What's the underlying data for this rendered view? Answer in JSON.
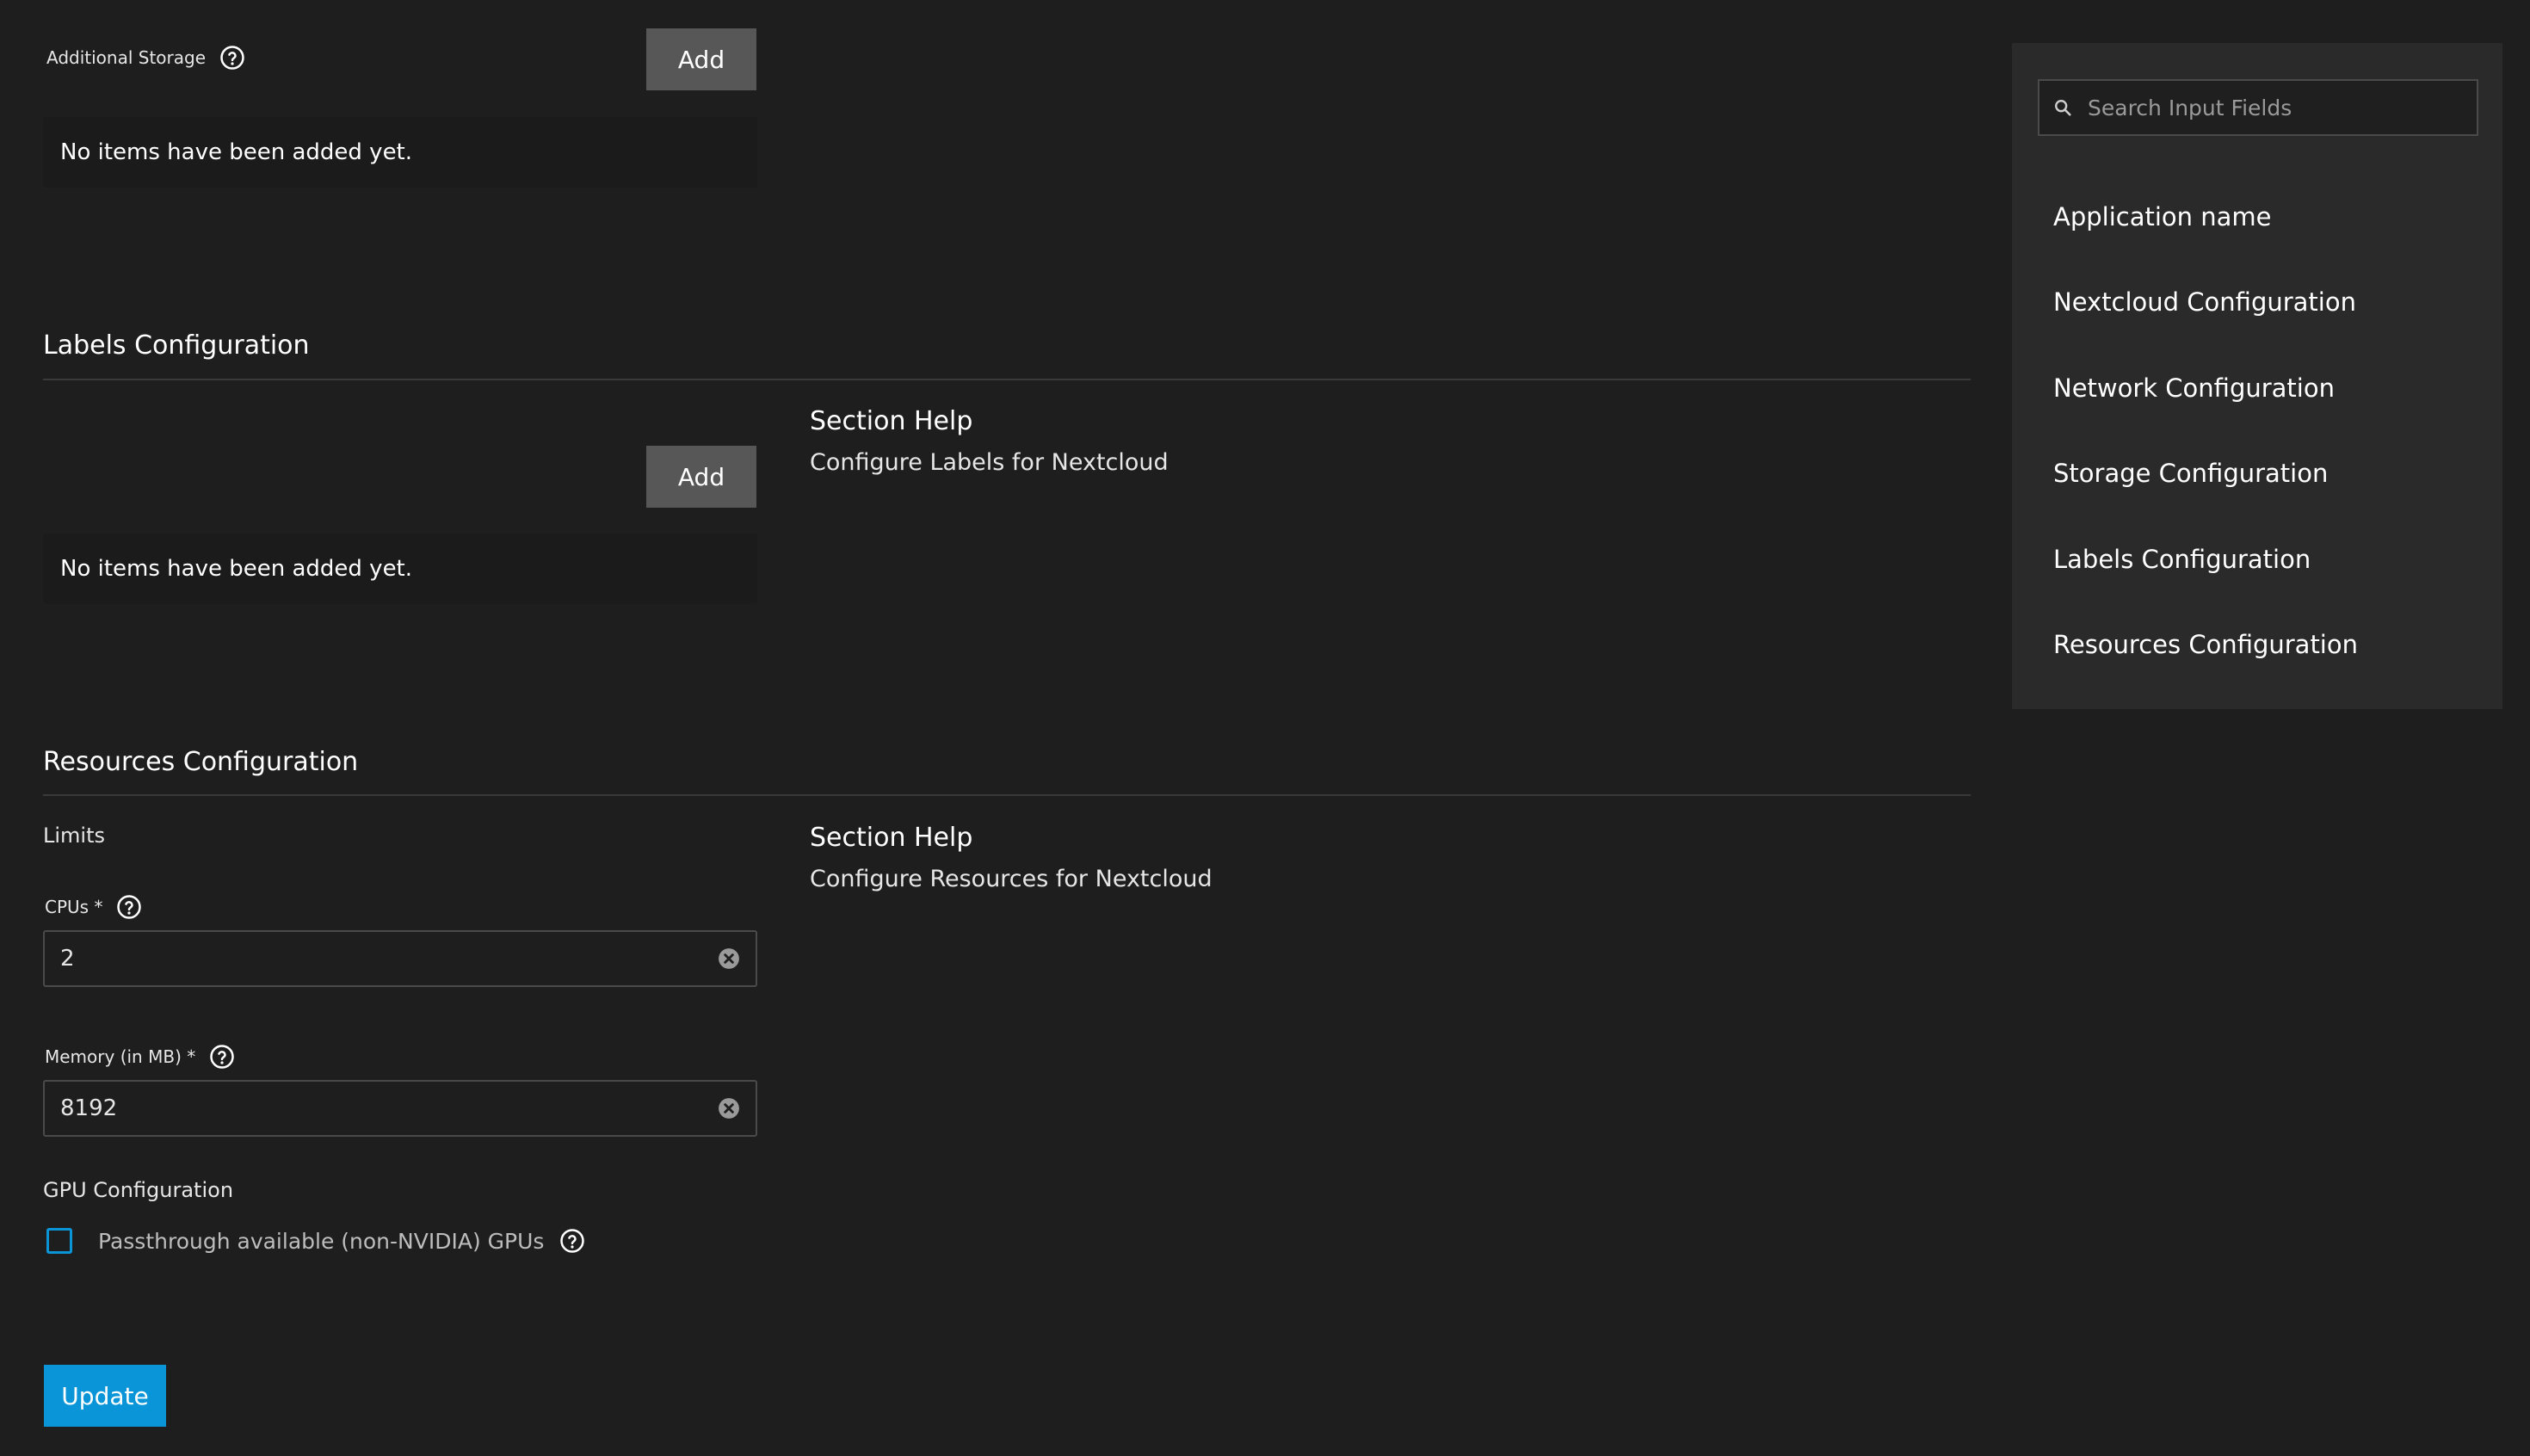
{
  "additional_storage": {
    "label": "Additional Storage",
    "add_label": "Add",
    "empty_text": "No items have been added yet."
  },
  "labels_section": {
    "title": "Labels Configuration",
    "add_label": "Add",
    "empty_text": "No items have been added yet.",
    "help_title": "Section Help",
    "help_text": "Configure Labels for Nextcloud"
  },
  "resources_section": {
    "title": "Resources Configuration",
    "limits_label": "Limits",
    "help_title": "Section Help",
    "help_text": "Configure Resources for Nextcloud",
    "cpus": {
      "label": "CPUs *",
      "value": "2"
    },
    "memory": {
      "label": "Memory (in MB) *",
      "value": "8192"
    },
    "gpu": {
      "label": "GPU Configuration",
      "checkbox_label": "Passthrough available (non-NVIDIA) GPUs",
      "checked": false
    }
  },
  "update_label": "Update",
  "side_nav": {
    "search_placeholder": "Search Input Fields",
    "items": [
      {
        "label": "Application name"
      },
      {
        "label": "Nextcloud Configuration"
      },
      {
        "label": "Network Configuration"
      },
      {
        "label": "Storage Configuration"
      },
      {
        "label": "Labels Configuration"
      },
      {
        "label": "Resources Configuration"
      }
    ]
  },
  "colors": {
    "background": "#1e1e1e",
    "panel": "#2a2a2a",
    "button_secondary": "#575757",
    "accent": "#0a95d8"
  },
  "icons": {
    "help": "help-circle-icon",
    "clear": "clear-circle-icon",
    "search": "search-icon"
  }
}
